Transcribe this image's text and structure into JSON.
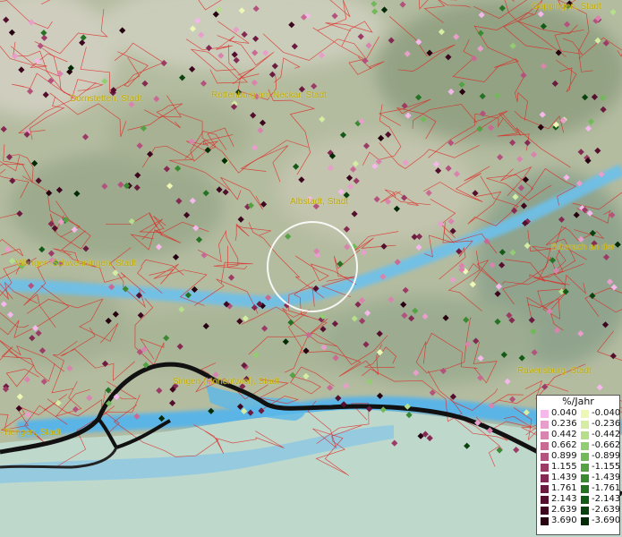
{
  "towns": [
    {
      "name": "Göppingen, Stadt"
    },
    {
      "name": "Dornstetten, Stadt"
    },
    {
      "name": "Rottenburg am Neckar, Stadt"
    },
    {
      "name": "Albstadt, Stadt"
    },
    {
      "name": "Villingen-Schwenningen, Stadt"
    },
    {
      "name": "Biberach an der"
    },
    {
      "name": "Ravensburg, Stadt"
    },
    {
      "name": "Singen (Hohentwiel), Stadt"
    },
    {
      "name": "-Tiengen, Stadt"
    }
  ],
  "legend": {
    "title": "%/Jahr",
    "positive": [
      {
        "value": "0.040",
        "color": "#f4b8ea"
      },
      {
        "value": "0.236",
        "color": "#e89ecb"
      },
      {
        "value": "0.442",
        "color": "#d884ae"
      },
      {
        "value": "0.662",
        "color": "#c96a94"
      },
      {
        "value": "0.899",
        "color": "#b3527c"
      },
      {
        "value": "1.155",
        "color": "#9c3c66"
      },
      {
        "value": "1.439",
        "color": "#852a52"
      },
      {
        "value": "1.761",
        "color": "#6c1b40"
      },
      {
        "value": "2.143",
        "color": "#540f2e"
      },
      {
        "value": "2.639",
        "color": "#3d071f"
      },
      {
        "value": "3.690",
        "color": "#270312"
      }
    ],
    "negative": [
      {
        "value": "-0.040",
        "color": "#eff7b4"
      },
      {
        "value": "-0.236",
        "color": "#d4eda2"
      },
      {
        "value": "-0.442",
        "color": "#b5df8b"
      },
      {
        "value": "-0.662",
        "color": "#93cd72"
      },
      {
        "value": "-0.899",
        "color": "#72b95a"
      },
      {
        "value": "-1.155",
        "color": "#55a244"
      },
      {
        "value": "-1.439",
        "color": "#3b8a33"
      },
      {
        "value": "-1.761",
        "color": "#267224"
      },
      {
        "value": "-2.143",
        "color": "#145a17"
      },
      {
        "value": "-2.639",
        "color": "#09420d"
      },
      {
        "value": "-3.690",
        "color": "#022b05"
      }
    ]
  },
  "colors": {
    "terrain": "#b8c0a4",
    "boundary": "#e0201c",
    "river": "#5ab4e6",
    "label": "#b8a600"
  }
}
